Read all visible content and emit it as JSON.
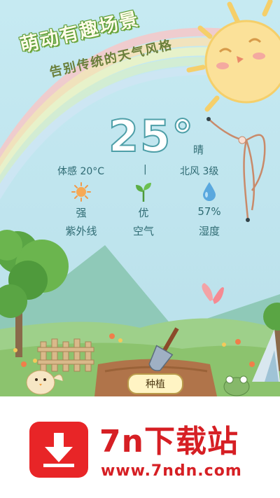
{
  "promo": {
    "headline": "萌动有趣场景",
    "subline": "告别传统的天气风格"
  },
  "weather": {
    "temperature": "25°",
    "condition": "晴",
    "feels_like": "体感 20°C",
    "separator": "|",
    "wind": "北风 3级",
    "metrics": [
      {
        "icon": "sun-icon",
        "value": "强",
        "label": "紫外线"
      },
      {
        "icon": "sprout-icon",
        "value": "优",
        "label": "空气"
      },
      {
        "icon": "water-drop-icon",
        "value": "57%",
        "label": "湿度"
      }
    ]
  },
  "garden": {
    "plant_button": "种植"
  },
  "banner": {
    "title": "7n下载站",
    "url": "www.7ndn.com"
  },
  "colors": {
    "sky": "#bfe4ee",
    "text": "#2f6b73",
    "brand_red": "#e82527"
  }
}
